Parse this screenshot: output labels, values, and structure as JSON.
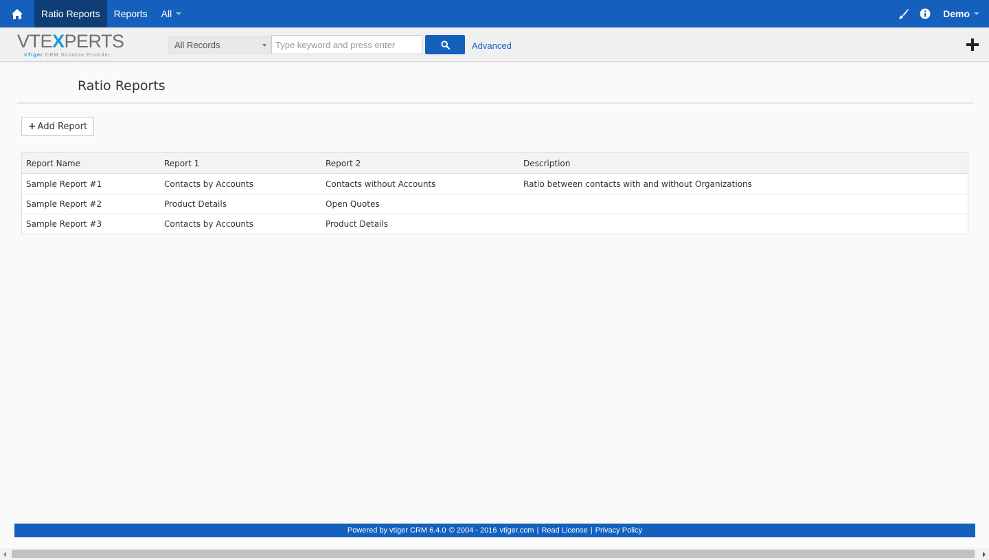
{
  "topnav": {
    "home_icon": "home-icon",
    "tabs": [
      {
        "label": "Ratio Reports",
        "active": true
      },
      {
        "label": "Reports",
        "active": false
      },
      {
        "label": "All",
        "active": false
      }
    ],
    "user": "Demo",
    "icons": [
      "brush-icon",
      "info-icon"
    ]
  },
  "search": {
    "logo_text_a": "VTE",
    "logo_text_x": "X",
    "logo_text_b": "PERTS",
    "logo_sub_a": "vTiger",
    "logo_sub_b": "CRM Solution Provider",
    "record_filter": "All Records",
    "placeholder": "Type keyword and press enter",
    "advanced_label": "Advanced"
  },
  "page": {
    "title": "Ratio Reports",
    "add_label": "Add Report"
  },
  "table": {
    "headers": [
      "Report Name",
      "Report 1",
      "Report 2",
      "Description"
    ],
    "rows": [
      [
        "Sample Report #1",
        "Contacts by Accounts",
        "Contacts without Accounts",
        "Ratio between contacts with and without Organizations"
      ],
      [
        "Sample Report #2",
        "Product Details",
        "Open Quotes",
        ""
      ],
      [
        "Sample Report #3",
        "Contacts by Accounts",
        "Product Details",
        ""
      ]
    ]
  },
  "footer": {
    "powered": "Powered by vtiger CRM 6.4.0",
    "copyright": "© 2004 - 2016",
    "site": "vtiger.com",
    "sep1": "|",
    "license": "Read License",
    "sep2": "|",
    "privacy": "Privacy Policy"
  },
  "colors": {
    "brand": "#1560bd",
    "active_tab": "#0f3e74"
  }
}
